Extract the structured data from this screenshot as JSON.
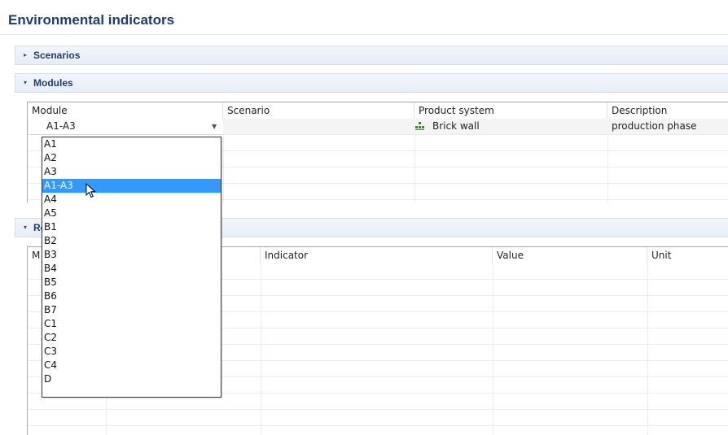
{
  "page": {
    "title": "Environmental indicators"
  },
  "sections": {
    "scenarios": {
      "label": "Scenarios",
      "twisty": "▸"
    },
    "modules": {
      "label": "Modules",
      "twisty": "▾"
    },
    "results": {
      "label": "Re",
      "twisty": "▾"
    }
  },
  "modules_table": {
    "columns": [
      "Module",
      "Scenario",
      "Product system",
      "Description"
    ],
    "row": {
      "module": "A1-A3",
      "scenario": "",
      "product_system": "Brick wall",
      "description": "production phase"
    }
  },
  "results_table": {
    "columns": [
      "M",
      "Indicator",
      "Value",
      "Unit"
    ]
  },
  "dropdown": {
    "selected": "A1-A3",
    "options": [
      "A1",
      "A2",
      "A3",
      "A1-A3",
      "A4",
      "A5",
      "B1",
      "B2",
      "B3",
      "B4",
      "B5",
      "B6",
      "B7",
      "C1",
      "C2",
      "C3",
      "C4",
      "D"
    ]
  },
  "colors": {
    "title": "#1d3d6e",
    "selection": "#3399ff",
    "section_bg": "#e9eff7",
    "product_icon": "#3a8a2e"
  },
  "icons": {
    "product_system": "product-system-icon",
    "cursor": "mouse-pointer-icon",
    "combo_arrow": "chevron-down-icon"
  }
}
